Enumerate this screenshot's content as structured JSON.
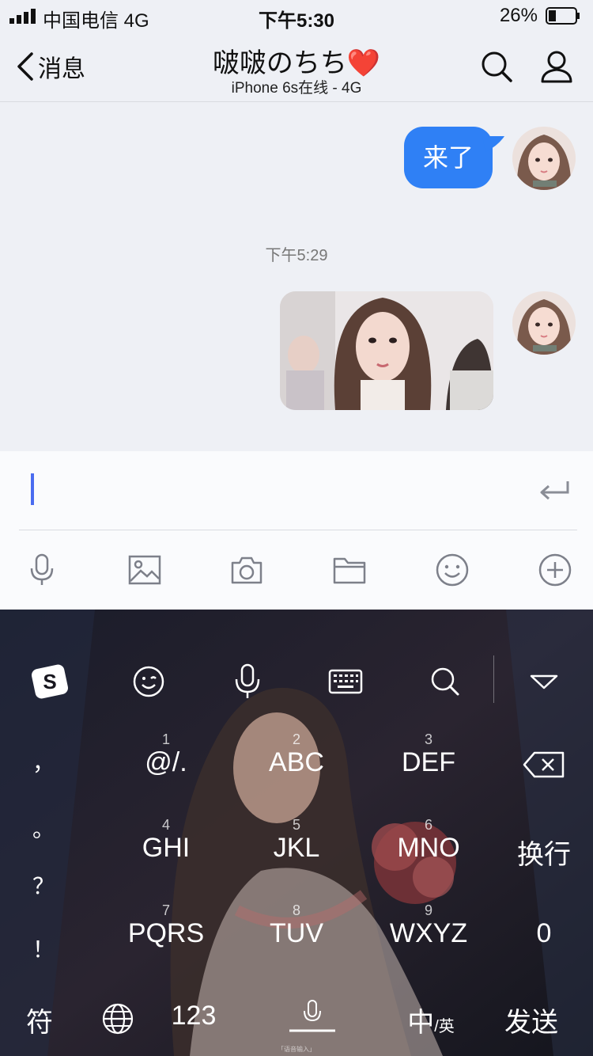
{
  "status_bar": {
    "carrier": "中国电信   4G",
    "time": "下午5:30",
    "battery": "26%"
  },
  "nav": {
    "back_label": "消息",
    "title": "啵啵のちち❤️",
    "subtitle": "iPhone 6s在线 - 4G"
  },
  "chat": {
    "messages": [
      {
        "type": "text",
        "text": "来了",
        "sender": "me"
      },
      {
        "type": "timestamp",
        "text": "下午5:29"
      },
      {
        "type": "image",
        "sender": "me"
      }
    ]
  },
  "input": {
    "value": ""
  },
  "toolbar_icons": [
    "mic-icon",
    "image-icon",
    "camera-icon",
    "folder-icon",
    "emoji-icon",
    "plus-icon"
  ],
  "keyboard": {
    "side_keys": [
      "，",
      "。",
      "？",
      "！"
    ],
    "rows": [
      {
        "keys": [
          {
            "num": "1",
            "label": "@/."
          },
          {
            "num": "2",
            "label": "ABC"
          },
          {
            "num": "3",
            "label": "DEF"
          }
        ]
      },
      {
        "keys": [
          {
            "num": "4",
            "label": "GHI"
          },
          {
            "num": "5",
            "label": "JKL"
          },
          {
            "num": "6",
            "label": "MNO"
          }
        ]
      },
      {
        "keys": [
          {
            "num": "7",
            "label": "PQRS"
          },
          {
            "num": "8",
            "label": "TUV"
          },
          {
            "num": "9",
            "label": "WXYZ"
          }
        ]
      }
    ],
    "enter_label": "换行",
    "zero_label": "0",
    "bottom": {
      "symbols": "符",
      "numbers": "123",
      "lang_main": "中",
      "lang_sub": "/英",
      "send": "发送"
    },
    "hint": "「语音输入」"
  },
  "colors": {
    "accent": "#2f80f5",
    "caret": "#4a6cf0"
  }
}
